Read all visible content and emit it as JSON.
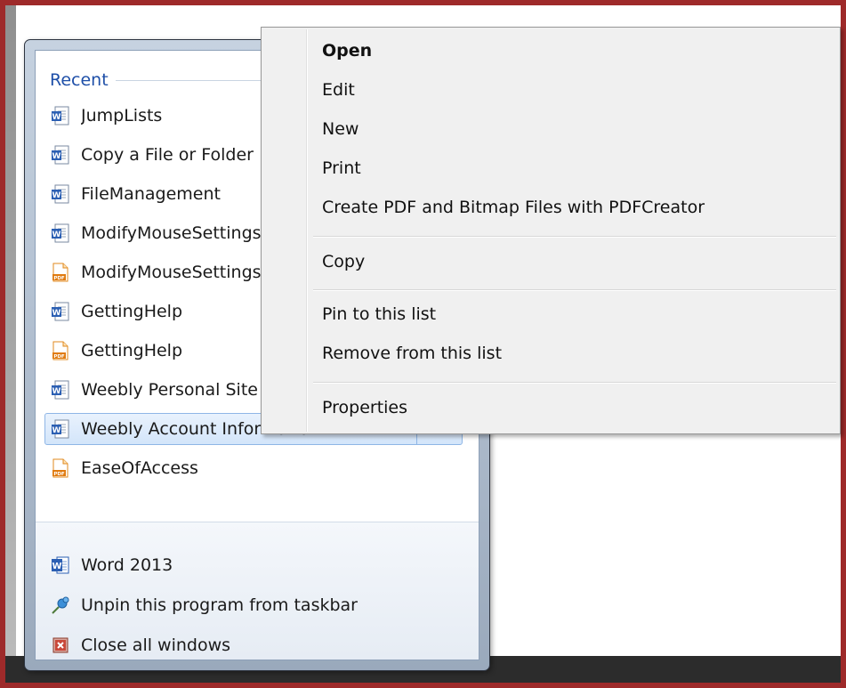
{
  "jumplist": {
    "recent_label": "Recent",
    "recent_items": [
      {
        "label": "JumpLists",
        "icon": "word-doc-icon"
      },
      {
        "label": "Copy a File or Folder",
        "icon": "word-doc-icon"
      },
      {
        "label": "FileManagement",
        "icon": "word-doc-icon"
      },
      {
        "label": "ModifyMouseSettings",
        "icon": "word-doc-icon"
      },
      {
        "label": "ModifyMouseSettings",
        "icon": "pdf-doc-icon"
      },
      {
        "label": "GettingHelp",
        "icon": "word-doc-icon"
      },
      {
        "label": "GettingHelp",
        "icon": "pdf-doc-icon"
      },
      {
        "label": "Weebly Personal Site",
        "icon": "word-doc-icon"
      },
      {
        "label": "Weebly Account Information",
        "icon": "word-doc-icon",
        "selected": true
      },
      {
        "label": "EaseOfAccess",
        "icon": "pdf-doc-icon"
      }
    ],
    "tasks": [
      {
        "label": "Word 2013",
        "icon": "word-app-icon"
      },
      {
        "label": "Unpin this program from taskbar",
        "icon": "unpin-icon"
      },
      {
        "label": "Close all windows",
        "icon": "close-windows-icon"
      }
    ]
  },
  "context_menu": {
    "items": [
      {
        "label": "Open",
        "bold": true
      },
      {
        "label": "Edit"
      },
      {
        "label": "New"
      },
      {
        "label": "Print"
      },
      {
        "label": "Create PDF and Bitmap Files with PDFCreator"
      },
      {
        "label": "Copy"
      },
      {
        "label": "Pin to this list"
      },
      {
        "label": "Remove from this list"
      },
      {
        "label": "Properties"
      }
    ]
  },
  "colors": {
    "frame": "#9e2a2a",
    "recent_header": "#1e4fa8",
    "selection": "#d3e5fa",
    "taskbar": "#2c2c2c"
  }
}
